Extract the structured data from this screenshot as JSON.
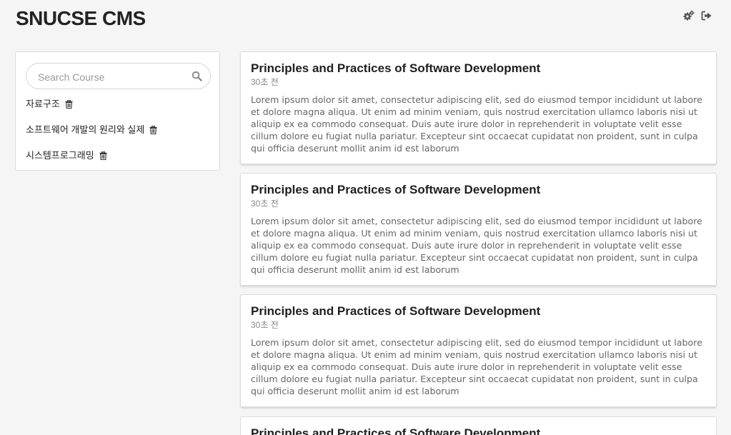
{
  "app": {
    "title": "SNUCSE CMS"
  },
  "header": {
    "icons": [
      "settings-icon",
      "logout-icon"
    ]
  },
  "sidebar": {
    "search": {
      "placeholder": "Search Course",
      "value": ""
    },
    "courses": [
      {
        "label": "자료구조"
      },
      {
        "label": "소프트웨어 개발의 원리와 실제"
      },
      {
        "label": "시스템프로그래밍"
      }
    ]
  },
  "posts": [
    {
      "title": "Principles and Practices of Software Development",
      "time": "30초 전",
      "body": "Lorem ipsum dolor sit amet, consectetur adipiscing elit, sed do eiusmod tempor incididunt ut labore et dolore magna aliqua. Ut enim ad minim veniam, quis nostrud exercitation ullamco laboris nisi ut aliquip ex ea commodo consequat. Duis aute irure dolor in reprehenderit in voluptate velit esse cillum dolore eu fugiat nulla pariatur. Excepteur sint occaecat cupidatat non proident, sunt in culpa qui officia deserunt mollit anim id est laborum"
    },
    {
      "title": "Principles and Practices of Software Development",
      "time": "30초 전",
      "body": "Lorem ipsum dolor sit amet, consectetur adipiscing elit, sed do eiusmod tempor incididunt ut labore et dolore magna aliqua. Ut enim ad minim veniam, quis nostrud exercitation ullamco laboris nisi ut aliquip ex ea commodo consequat. Duis aute irure dolor in reprehenderit in voluptate velit esse cillum dolore eu fugiat nulla pariatur. Excepteur sint occaecat cupidatat non proident, sunt in culpa qui officia deserunt mollit anim id est laborum"
    },
    {
      "title": "Principles and Practices of Software Development",
      "time": "30초 전",
      "body": "Lorem ipsum dolor sit amet, consectetur adipiscing elit, sed do eiusmod tempor incididunt ut labore et dolore magna aliqua. Ut enim ad minim veniam, quis nostrud exercitation ullamco laboris nisi ut aliquip ex ea commodo consequat. Duis aute irure dolor in reprehenderit in voluptate velit esse cillum dolore eu fugiat nulla pariatur. Excepteur sint occaecat cupidatat non proident, sunt in culpa qui officia deserunt mollit anim id est laborum"
    },
    {
      "title": "Principles and Practices of Software Development"
    }
  ]
}
